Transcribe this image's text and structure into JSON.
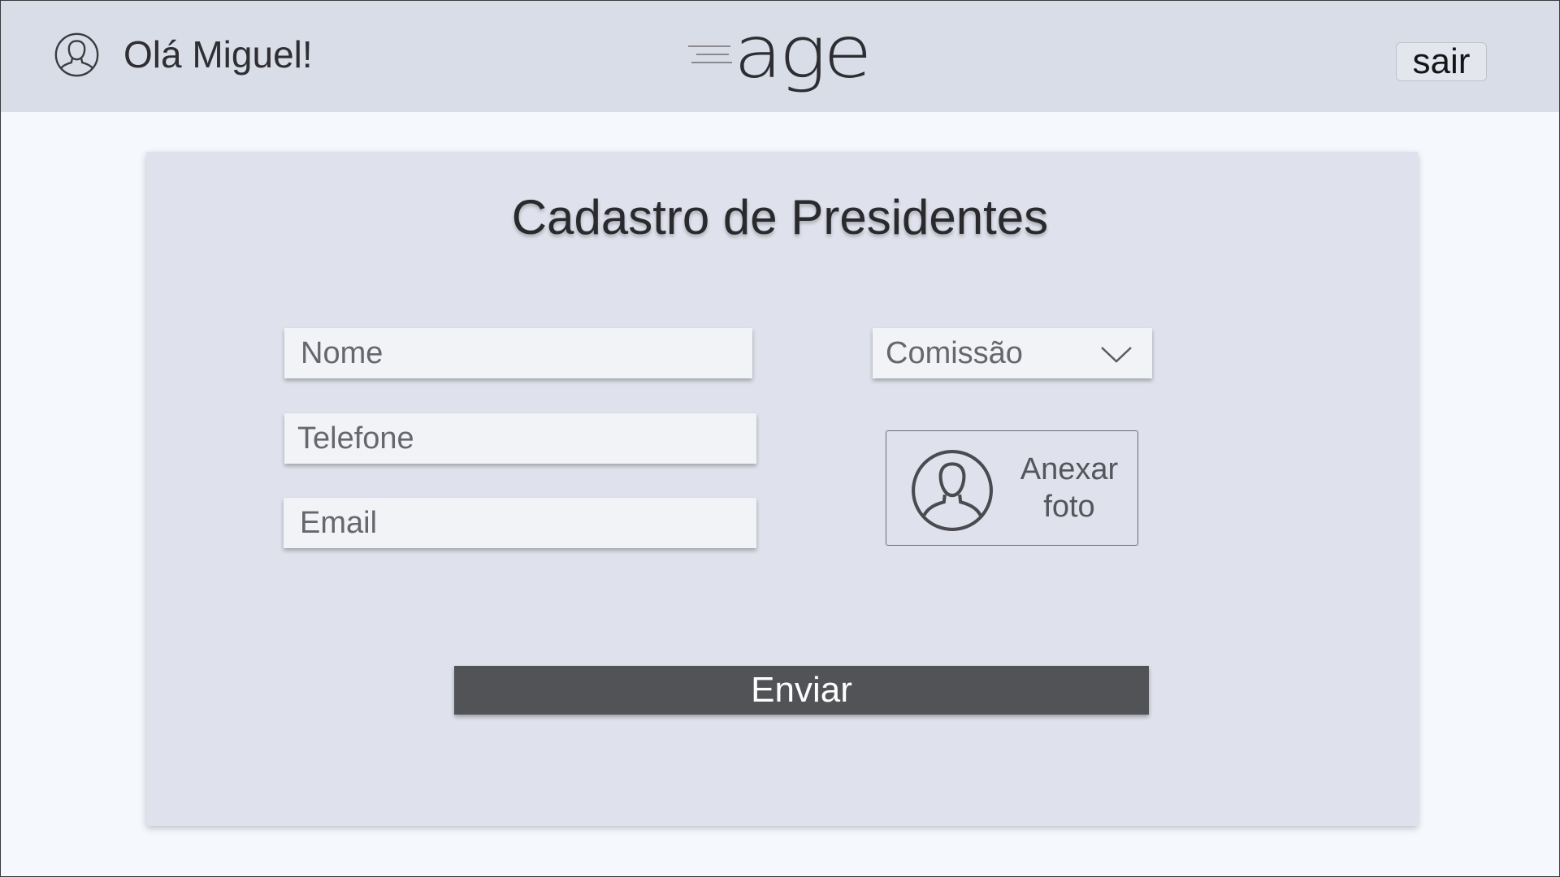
{
  "header": {
    "greeting": "Olá Miguel!",
    "logo_text": "age",
    "logout_label": "sair"
  },
  "form": {
    "title": "Cadastro de Presidentes",
    "name_placeholder": "Nome",
    "phone_placeholder": "Telefone",
    "email_placeholder": "Email",
    "commission_select": "Comissão",
    "attach_photo_line1": "Anexar",
    "attach_photo_line2": "foto",
    "submit_label": "Enviar"
  },
  "icons": {
    "user": "user-circle-icon",
    "chevron": "chevron-down-icon",
    "photo": "person-silhouette-icon"
  },
  "colors": {
    "header_bg": "#d9dde7",
    "page_bg": "#f5f8fd",
    "card_bg": "#dfe2ec",
    "button_bg": "#525357"
  }
}
